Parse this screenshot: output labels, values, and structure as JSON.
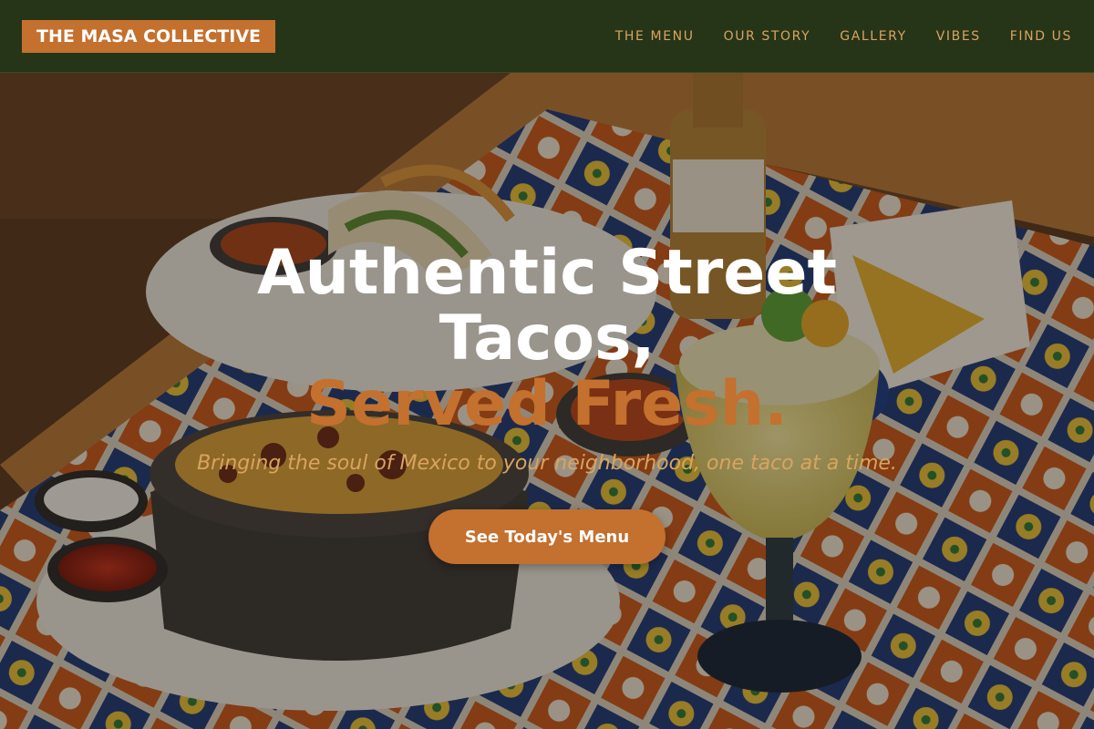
{
  "brand": {
    "name": "THE MASA COLLECTIVE"
  },
  "nav": {
    "items": [
      {
        "label": "THE MENU"
      },
      {
        "label": "OUR STORY"
      },
      {
        "label": "GALLERY"
      },
      {
        "label": "VIBES"
      },
      {
        "label": "FIND US"
      }
    ]
  },
  "hero": {
    "title_line1": "Authentic Street Tacos,",
    "title_accent": "Served Fresh.",
    "subtitle": "Bringing the soul of Mexico to your neighborhood, one taco at a time.",
    "cta_label": "See Today's Menu"
  },
  "colors": {
    "header_bg": "#263418",
    "accent": "#c4702e",
    "nav_text": "#d9a45f",
    "title_text": "#ffffff"
  }
}
